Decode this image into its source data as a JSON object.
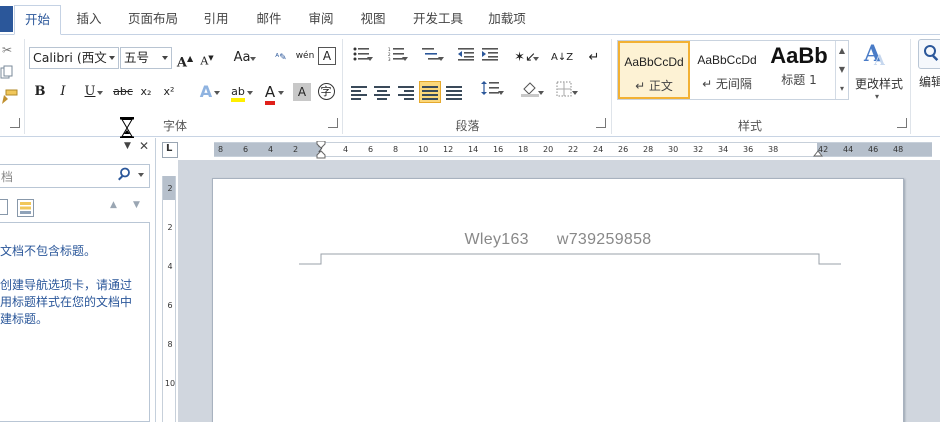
{
  "tabs": [
    "开始",
    "插入",
    "页面布局",
    "引用",
    "邮件",
    "审阅",
    "视图",
    "开发工具",
    "加载项"
  ],
  "font": {
    "name": "Calibri (西文",
    "size": "五号",
    "grow_icon": "A",
    "shrink_icon": "A",
    "change_case": "Aa",
    "phonetic": "wén",
    "bold": "B",
    "italic": "I",
    "underline": "U",
    "strike": "abc",
    "subscript": "x₂",
    "superscript": "x²",
    "effects": "A",
    "highlight": "ab",
    "color": "A",
    "shading": "A",
    "enclose": "字",
    "group_label": "字体"
  },
  "paragraph": {
    "group_label": "段落"
  },
  "styles": {
    "items": [
      {
        "sample": "AaBbCcDd",
        "name": "↵ 正文"
      },
      {
        "sample": "AaBbCcDd",
        "name": "↵ 无间隔"
      },
      {
        "sample": "AaBb",
        "name": "标题 1"
      }
    ],
    "change_label": "更改样式",
    "group_label": "样式",
    "edit_label": "编辑"
  },
  "nav": {
    "search_placeholder": "档",
    "message_lines": [
      "文档不包含标题。",
      "创建导航选项卡，请通过",
      "用标题样式在您的文档中",
      "建标题。"
    ],
    "close_icon": "✕",
    "menu_icon": "▼"
  },
  "ruler": {
    "h_ticks": [
      "8",
      "6",
      "4",
      "2",
      "2",
      "4",
      "6",
      "8",
      "10",
      "12",
      "14",
      "16",
      "18",
      "20",
      "22",
      "24",
      "26",
      "28",
      "30",
      "32",
      "34",
      "36",
      "38",
      "42",
      "44",
      "46",
      "48"
    ],
    "v_ticks": [
      "2",
      "2",
      "4",
      "6",
      "8",
      "10"
    ],
    "corner": "L"
  },
  "document": {
    "header_left": "Wley163",
    "header_right": "w739259858"
  },
  "colors": {
    "accent": "#2b579a",
    "style_selected_border": "#f2b134",
    "document_background": "#d0d6de"
  }
}
